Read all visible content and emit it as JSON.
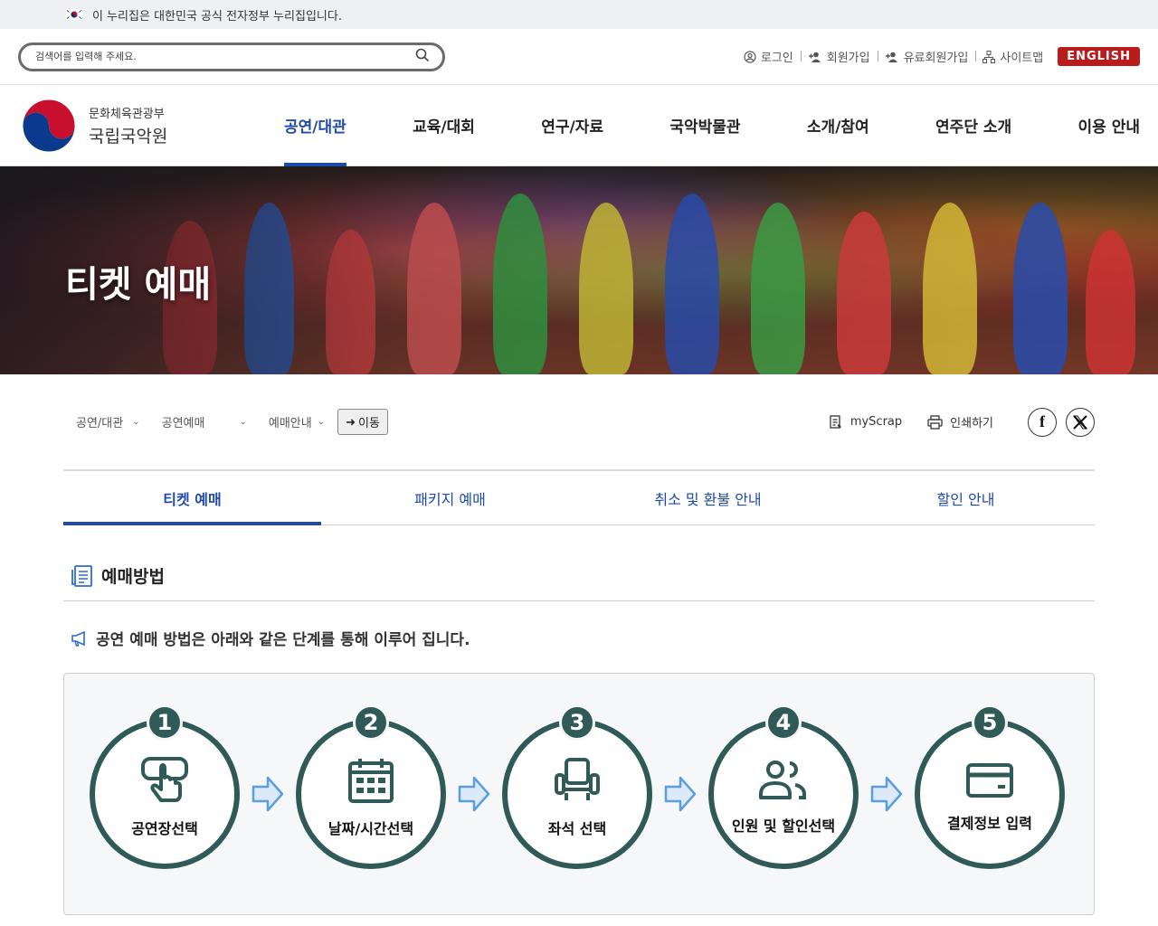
{
  "gov_banner": {
    "text": "이 누리집은 대한민국 공식 전자정부 누리집입니다."
  },
  "search": {
    "placeholder": "검색어를 입력해 주세요."
  },
  "util_links": [
    {
      "label": "로그인",
      "icon": "user-circle-icon"
    },
    {
      "label": "회원가입",
      "icon": "user-plus-icon"
    },
    {
      "label": "유료회원가입",
      "icon": "user-plus-icon"
    },
    {
      "label": "사이트맵",
      "icon": "sitemap-icon"
    }
  ],
  "english_label": "ENGLISH",
  "logo": {
    "sub": "문화체육관광부",
    "main": "국립국악원"
  },
  "gnb": [
    "공연/대관",
    "교육/대회",
    "연구/자료",
    "국악박물관",
    "소개/참여",
    "연주단 소개",
    "이용 안내"
  ],
  "hero": {
    "title": "티켓 예매"
  },
  "breadcrumb": {
    "items": [
      "공연/대관",
      "공연예매",
      "예매안내"
    ],
    "go_label": "이동"
  },
  "tools": {
    "scrap": "myScrap",
    "print": "인쇄하기"
  },
  "tabs": [
    "티켓 예매",
    "패키지 예매",
    "취소 및 환불 안내",
    "할인 안내"
  ],
  "section": {
    "title": "예매방법",
    "notice": "공연 예매 방법은 아래와 같은 단계를 통해 이루어 집니다."
  },
  "steps": [
    {
      "num": "1",
      "label": "공연장선택",
      "icon": "touch-hand-icon"
    },
    {
      "num": "2",
      "label": "날짜/시간선택",
      "icon": "calendar-icon"
    },
    {
      "num": "3",
      "label": "좌석 선택",
      "icon": "seat-icon"
    },
    {
      "num": "4",
      "label": "인원 및 할인선택",
      "icon": "users-icon"
    },
    {
      "num": "5",
      "label": "결제정보 입력",
      "icon": "credit-card-icon"
    }
  ],
  "colors": {
    "accent": "#1f4aa8",
    "step_ring": "#2f5a58",
    "english_btn": "#b91c1c"
  }
}
